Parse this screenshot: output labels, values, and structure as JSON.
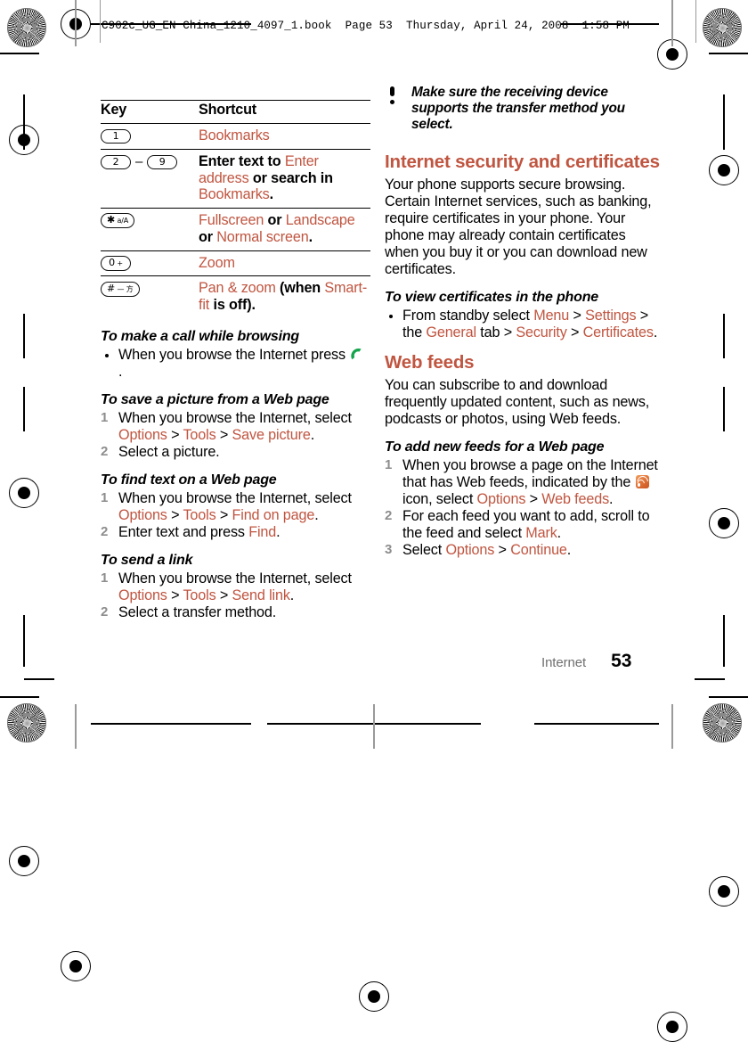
{
  "page": {
    "header_line": "C902c_UG_EN China_1210_4097_1.book  Page 53  Thursday, April 24, 2008  1:58 PM",
    "footer_section": "Internet",
    "footer_page": "53",
    "accent_color": "#c05540",
    "step_number_color": "#8d8d8d"
  },
  "table": {
    "headers": [
      "Key",
      "Shortcut"
    ],
    "rows": [
      {
        "key_glyph": "1",
        "key_glyph_sub": "",
        "key_range_end": "",
        "shortcut_parts": [
          {
            "text": "Bookmarks",
            "accent": true
          }
        ]
      },
      {
        "key_glyph": "2",
        "key_glyph_sub": "",
        "key_range_end": "9",
        "shortcut_parts": [
          {
            "text": "Enter text to ",
            "accent": false,
            "bold": true
          },
          {
            "text": "Enter address",
            "accent": true
          },
          {
            "text": " or search in ",
            "accent": false,
            "bold": true
          },
          {
            "text": "Bookmarks",
            "accent": true
          },
          {
            "text": ".",
            "accent": false,
            "bold": true
          }
        ]
      },
      {
        "key_glyph": "✱",
        "key_glyph_sub": "a/A",
        "key_range_end": "",
        "shortcut_parts": [
          {
            "text": "Fullscreen",
            "accent": true
          },
          {
            "text": " or ",
            "accent": false,
            "bold": true
          },
          {
            "text": "Landscape",
            "accent": true
          },
          {
            "text": " or ",
            "accent": false,
            "bold": true
          },
          {
            "text": "Normal screen",
            "accent": true
          },
          {
            "text": ".",
            "accent": false,
            "bold": true
          }
        ]
      },
      {
        "key_glyph": "0",
        "key_glyph_sub": "+",
        "key_range_end": "",
        "shortcut_parts": [
          {
            "text": "Zoom",
            "accent": true
          }
        ]
      },
      {
        "key_glyph": "#",
        "key_glyph_sub": "— 方",
        "key_range_end": "",
        "shortcut_parts": [
          {
            "text": "Pan & zoom",
            "accent": true
          },
          {
            "text": " (when ",
            "accent": false,
            "bold": true
          },
          {
            "text": "Smart-fit",
            "accent": true
          },
          {
            "text": " is off).",
            "accent": false,
            "bold": true
          }
        ]
      }
    ]
  },
  "left_column": {
    "proc_call": {
      "title": "To make a call while browsing",
      "bullet_pre": "When you browse the Internet press",
      "bullet_icon": "call-icon",
      "bullet_post": "."
    },
    "proc_save_picture": {
      "title": "To save a picture from a Web page",
      "steps": [
        {
          "num": "1",
          "parts": [
            {
              "text": "When you browse the Internet, select ",
              "accent": false
            },
            {
              "text": "Options",
              "accent": true
            },
            {
              "text": " > ",
              "accent": false
            },
            {
              "text": "Tools",
              "accent": true
            },
            {
              "text": " > ",
              "accent": false
            },
            {
              "text": "Save picture",
              "accent": true
            },
            {
              "text": ".",
              "accent": false
            }
          ]
        },
        {
          "num": "2",
          "parts": [
            {
              "text": "Select a picture.",
              "accent": false
            }
          ]
        }
      ]
    },
    "proc_find_text": {
      "title": "To find text on a Web page",
      "steps": [
        {
          "num": "1",
          "parts": [
            {
              "text": "When you browse the Internet, select ",
              "accent": false
            },
            {
              "text": "Options",
              "accent": true
            },
            {
              "text": " > ",
              "accent": false
            },
            {
              "text": "Tools",
              "accent": true
            },
            {
              "text": " > ",
              "accent": false
            },
            {
              "text": "Find on page",
              "accent": true
            },
            {
              "text": ".",
              "accent": false
            }
          ]
        },
        {
          "num": "2",
          "parts": [
            {
              "text": "Enter text and press ",
              "accent": false
            },
            {
              "text": "Find",
              "accent": true
            },
            {
              "text": ".",
              "accent": false
            }
          ]
        }
      ]
    },
    "proc_send_link": {
      "title": "To send a link",
      "steps": [
        {
          "num": "1",
          "parts": [
            {
              "text": "When you browse the Internet, select ",
              "accent": false
            },
            {
              "text": "Options",
              "accent": true
            },
            {
              "text": " > ",
              "accent": false
            },
            {
              "text": "Tools",
              "accent": true
            },
            {
              "text": " > ",
              "accent": false
            },
            {
              "text": "Send link",
              "accent": true
            },
            {
              "text": ".",
              "accent": false
            }
          ]
        },
        {
          "num": "2",
          "parts": [
            {
              "text": "Select a transfer method.",
              "accent": false
            }
          ]
        }
      ]
    }
  },
  "right_column": {
    "note": "Make sure the receiving device supports the transfer method you select.",
    "security": {
      "heading": "Internet security and certificates",
      "body": "Your phone supports secure browsing. Certain Internet services, such as banking, require certificates in your phone. Your phone may already contain certificates when you buy it or you can download new certificates.",
      "proc_title": "To view certificates in the phone",
      "bullet_parts": [
        {
          "text": "From standby select ",
          "accent": false
        },
        {
          "text": "Menu",
          "accent": true
        },
        {
          "text": " > ",
          "accent": false
        },
        {
          "text": "Settings",
          "accent": true
        },
        {
          "text": " > the ",
          "accent": false
        },
        {
          "text": "General",
          "accent": true
        },
        {
          "text": " tab > ",
          "accent": false
        },
        {
          "text": "Security",
          "accent": true
        },
        {
          "text": " > ",
          "accent": false
        },
        {
          "text": "Certificates",
          "accent": true
        },
        {
          "text": ".",
          "accent": false
        }
      ]
    },
    "webfeeds": {
      "heading": "Web feeds",
      "body": "You can subscribe to and download frequently updated content, such as news, podcasts or photos, using Web feeds.",
      "proc_title": "To add new feeds for a Web page",
      "steps": [
        {
          "num": "1",
          "parts": [
            {
              "text": "When you browse a page on the Internet that has Web feeds, indicated by the ",
              "accent": false
            },
            {
              "icon": "rss-icon"
            },
            {
              "text": " icon, select ",
              "accent": false
            },
            {
              "text": "Options",
              "accent": true
            },
            {
              "text": " > ",
              "accent": false
            },
            {
              "text": "Web feeds",
              "accent": true
            },
            {
              "text": ".",
              "accent": false
            }
          ]
        },
        {
          "num": "2",
          "parts": [
            {
              "text": "For each feed you want to add, scroll to the feed and select ",
              "accent": false
            },
            {
              "text": "Mark",
              "accent": true
            },
            {
              "text": ".",
              "accent": false
            }
          ]
        },
        {
          "num": "3",
          "parts": [
            {
              "text": "Select ",
              "accent": false
            },
            {
              "text": "Options",
              "accent": true
            },
            {
              "text": " > ",
              "accent": false
            },
            {
              "text": "Continue",
              "accent": true
            },
            {
              "text": ".",
              "accent": false
            }
          ]
        }
      ]
    }
  }
}
